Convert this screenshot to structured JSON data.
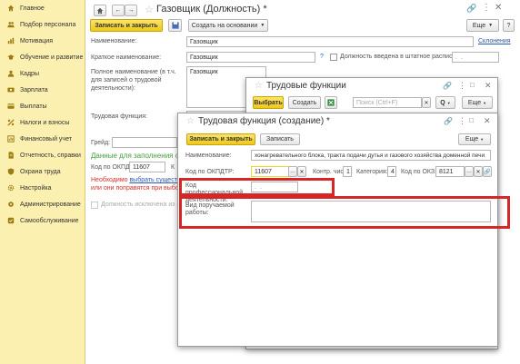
{
  "sidebar": {
    "items": [
      {
        "label": "Главное",
        "icon": "home-icon"
      },
      {
        "label": "Подбор персонала",
        "icon": "people-icon"
      },
      {
        "label": "Мотивация",
        "icon": "chart-icon"
      },
      {
        "label": "Обучение и развитие",
        "icon": "education-icon"
      },
      {
        "label": "Кадры",
        "icon": "person-icon"
      },
      {
        "label": "Зарплата",
        "icon": "salary-icon"
      },
      {
        "label": "Выплаты",
        "icon": "payments-icon"
      },
      {
        "label": "Налоги и взносы",
        "icon": "taxes-icon"
      },
      {
        "label": "Финансовый учет",
        "icon": "finance-icon"
      },
      {
        "label": "Отчетность, справки",
        "icon": "reports-icon"
      },
      {
        "label": "Охрана труда",
        "icon": "safety-icon"
      },
      {
        "label": "Настройка",
        "icon": "settings-icon"
      },
      {
        "label": "Администрирование",
        "icon": "admin-icon"
      },
      {
        "label": "Самообслуживание",
        "icon": "selfservice-icon"
      }
    ]
  },
  "main": {
    "title": "Газовщик (Должность) *",
    "save_close": "Записать и закрыть",
    "create_based": "Создать на основании",
    "more": "Еще",
    "help": "?",
    "name_label": "Наименование:",
    "name_value": "Газовщик",
    "declensions": "Склонения",
    "short_label": "Краткое наименование:",
    "short_value": "Газовщик",
    "staff_checkbox": "Должность введена в штатное расписание",
    "staff_date": ". .",
    "full_label": "Полное наименование (в т.ч. для записей о трудовой деятельности):",
    "full_value": "Газовщик",
    "labor_func_label": "Трудовая функция:",
    "grade_label": "Грейд:",
    "green_text": "Данные для заполнения от",
    "okpdtr_label": "Код по ОКПДТР:",
    "okpdtr_value": "11607",
    "okpdtr_letter": "К",
    "red_line1": "Необходимо",
    "red_link": "выбрать существ",
    "red_line2": "или они поправятся при выборе",
    "excluded_checkbox": "Должность исключена из ш"
  },
  "functions_window": {
    "title": "Трудовые функции",
    "select": "Выбрать",
    "create": "Создать",
    "search_placeholder": "Поиск (Ctrl+F)",
    "search_icon": "Q",
    "more": "Еще",
    "help": "?"
  },
  "create_window": {
    "title": "Трудовая функция (создание) *",
    "save_close": "Записать и закрыть",
    "save": "Записать",
    "more": "Еще",
    "name_label": "Наименование:",
    "name_value": "хонагревательного блока, тракта подачи дутья и газового хозяйства доменной печи",
    "okpdtr_label": "Код по ОКПДТР:",
    "okpdtr_value": "11607",
    "control_label": "Контр. число:",
    "control_value": "1",
    "category_label": "Категория:",
    "category_value": "4",
    "okz_label": "Код по ОКЗ:",
    "okz_value": "8121",
    "prof_label": "Код профессиональной деятельности:",
    "prof_value": ". .",
    "work_label": "Вид поручаемой работы:"
  },
  "colors": {
    "sidebar_bg": "#fbf0b0",
    "accent_yellow": "#f5d327",
    "highlight_red": "#d62727",
    "link_blue": "#2a59b3",
    "green_text": "#45a03c"
  }
}
